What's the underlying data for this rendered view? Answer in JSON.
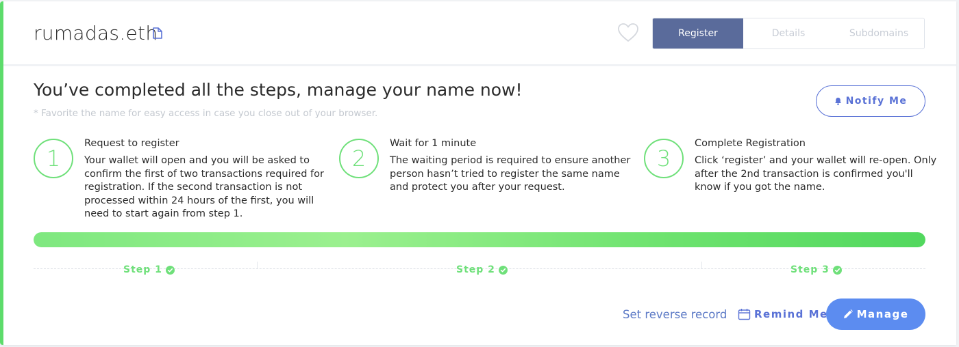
{
  "header": {
    "domain_name": "rumadas.eth",
    "tabs": [
      {
        "label": "Register",
        "active": true
      },
      {
        "label": "Details",
        "active": false
      },
      {
        "label": "Subdomains",
        "active": false
      }
    ]
  },
  "main": {
    "title": "You’ve completed all the steps, manage your name now!",
    "subnote": "* Favorite the name for easy access in case you close out of your browser.",
    "notify_label": "Notify Me"
  },
  "steps": [
    {
      "number": "1",
      "title": "Request to register",
      "lines": [
        "Your wallet will open and you will be asked to",
        "confirm the first of two transactions required for",
        "registration. If the second transaction is not",
        "processed within 24 hours of the first, you will",
        "need to start again from step 1."
      ],
      "label": "Step 1"
    },
    {
      "number": "2",
      "title": "Wait for 1 minute",
      "lines": [
        "The waiting period is required to ensure another",
        "person hasn’t tried to register the same name",
        "and protect you after your request."
      ],
      "label": "Step 2"
    },
    {
      "number": "3",
      "title": "Complete Registration",
      "lines": [
        "Click ‘register’ and your wallet will re-open. Only",
        "after the 2nd transaction is confirmed you'll",
        "know if you got the name."
      ],
      "label": "Step 3"
    }
  ],
  "progress": {
    "fraction": 1.0
  },
  "actions": {
    "reverse_record": "Set reverse record",
    "remind": "Remind Me",
    "manage": "Manage"
  },
  "colors": {
    "accent_green": "#6fe07a",
    "tab_active": "#5a6b9b",
    "link_blue": "#5a72d6",
    "manage_blue": "#5c8cf0"
  },
  "icons": {
    "copy": "copy-icon",
    "favorite": "heart-icon",
    "notify": "bell-icon",
    "step_done": "check-circle-icon",
    "remind": "calendar-icon",
    "manage": "pencil-icon"
  }
}
